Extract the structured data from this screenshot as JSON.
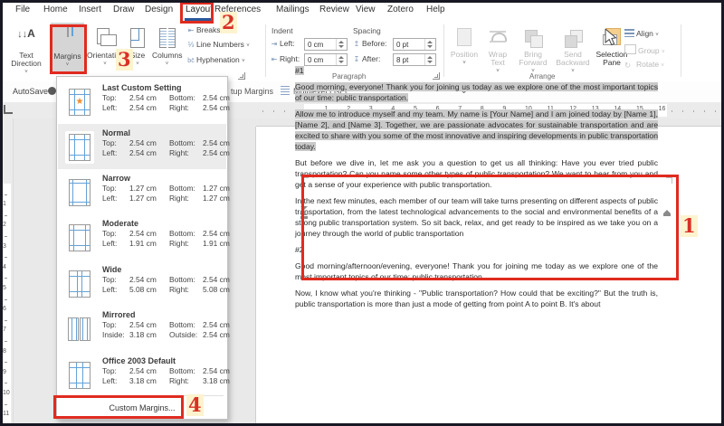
{
  "menu": {
    "items": [
      "File",
      "Home",
      "Insert",
      "Draw",
      "Design",
      "Layout",
      "References",
      "Mailings",
      "Review",
      "View",
      "Zotero",
      "Help"
    ]
  },
  "ribbon": {
    "text_direction": "Text Direction",
    "margins": "Margins",
    "orientation": "Orientation",
    "size": "Size",
    "columns": "Columns",
    "breaks": "Breaks",
    "line_numbers": "Line Numbers",
    "hyphenation": "Hyphenation",
    "indent_title": "Indent",
    "indent_left_label": "Left:",
    "indent_left_value": "0 cm",
    "indent_right_label": "Right:",
    "indent_right_value": "0 cm",
    "spacing_title": "Spacing",
    "spacing_before_label": "Before:",
    "spacing_before_value": "0 pt",
    "spacing_after_label": "After:",
    "spacing_after_value": "8 pt",
    "paragraph_group_label": "Paragraph",
    "arrange": {
      "position": "Position",
      "wrap_text": "Wrap Text",
      "bring_forward": "Bring Forward",
      "send_backward": "Send Backward",
      "selection_pane": "Selection Pane",
      "align": "Align",
      "group": "Group",
      "rotate": "Rotate",
      "group_label": "Arrange"
    }
  },
  "quickbar": {
    "autosave": "AutoSave",
    "clipped_text": "tup Margins",
    "multilevel": "Multilevel List"
  },
  "ruler": {
    "h": [
      "1",
      "2",
      "3",
      "4",
      "5",
      "6",
      "7",
      "8",
      "9",
      "10",
      "11",
      "12",
      "13",
      "14",
      "15",
      "16"
    ],
    "v": [
      "1",
      "2",
      "3",
      "4",
      "5",
      "6",
      "7",
      "8",
      "9",
      "10",
      "11"
    ]
  },
  "margins_menu": {
    "items": [
      {
        "name": "Last Custom Setting",
        "r1": [
          "Top:",
          "2.54 cm",
          "Bottom:",
          "2.54 cm"
        ],
        "r2": [
          "Left:",
          "2.54 cm",
          "Right:",
          "2.54 cm"
        ]
      },
      {
        "name": "Normal",
        "r1": [
          "Top:",
          "2.54 cm",
          "Bottom:",
          "2.54 cm"
        ],
        "r2": [
          "Left:",
          "2.54 cm",
          "Right:",
          "2.54 cm"
        ]
      },
      {
        "name": "Narrow",
        "r1": [
          "Top:",
          "1.27 cm",
          "Bottom:",
          "1.27 cm"
        ],
        "r2": [
          "Left:",
          "1.27 cm",
          "Right:",
          "1.27 cm"
        ]
      },
      {
        "name": "Moderate",
        "r1": [
          "Top:",
          "2.54 cm",
          "Bottom:",
          "2.54 cm"
        ],
        "r2": [
          "Left:",
          "1.91 cm",
          "Right:",
          "1.91 cm"
        ]
      },
      {
        "name": "Wide",
        "r1": [
          "Top:",
          "2.54 cm",
          "Bottom:",
          "2.54 cm"
        ],
        "r2": [
          "Left:",
          "5.08 cm",
          "Right:",
          "5.08 cm"
        ]
      },
      {
        "name": "Mirrored",
        "r1": [
          "Top:",
          "2.54 cm",
          "Bottom:",
          "2.54 cm"
        ],
        "r2": [
          "Inside:",
          "3.18 cm",
          "Outside:",
          "2.54 cm"
        ]
      },
      {
        "name": "Office 2003 Default",
        "r1": [
          "Top:",
          "2.54 cm",
          "Bottom:",
          "2.54 cm"
        ],
        "r2": [
          "Left:",
          "3.18 cm",
          "Right:",
          "3.18 cm"
        ]
      }
    ],
    "custom_label": "Custom Margins..."
  },
  "annotations": {
    "step1": "1",
    "step2": "2",
    "step3": "3",
    "step4": "4"
  },
  "document": {
    "paragraphs": [
      {
        "text": "#1",
        "selected": true
      },
      {
        "text": "Good morning, everyone! Thank you for joining us today as we explore one of the most important topics of our time: public transportation.",
        "selected": true
      },
      {
        "text": "Allow me to introduce myself and my team. My name is [Your Name] and I am joined today by [Name 1], [Name 2], and [Name 3]. Together, we are passionate advocates for sustainable transportation and are excited to share with you some of the most innovative and inspiring developments in public transportation today.",
        "selected": true
      },
      {
        "text": "But before we dive in, let me ask you a question to get us all thinking: Have you ever tried public transportation? Can you name some other types of public transportation? We want to hear from you and get a sense of your experience with public transportation.",
        "selected": false
      },
      {
        "text": "In the next few minutes, each member of our team will take turns presenting on different aspects of public transportation, from the latest technological advancements to the social and environmental benefits of a strong public transportation system. So sit back, relax, and get ready to be inspired as we take you on a journey through the world of public transportation",
        "selected": false
      },
      {
        "text": "#2",
        "selected": false
      },
      {
        "text": "Good morning/afternoon/evening, everyone! Thank you for joining me today as we explore one of the most important topics of our time: public transportation.",
        "selected": false
      },
      {
        "text": "Now, I know what you're thinking - \"Public transportation? How could that be exciting?\" But the truth is, public transportation is more than just a mode of getting from point A to point B. It's about",
        "selected": false
      }
    ]
  }
}
